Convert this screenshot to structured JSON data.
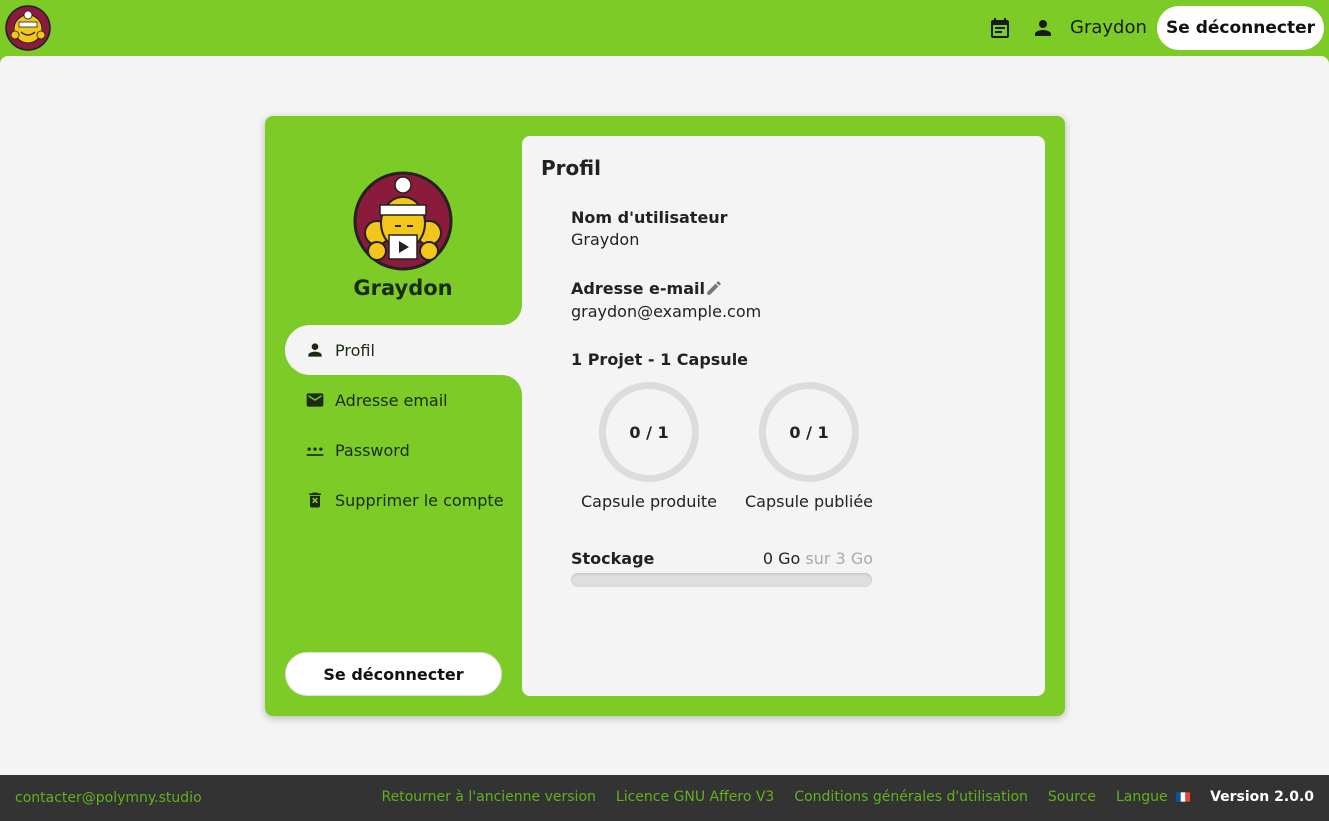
{
  "app": {
    "brand_color": "#7ccb27",
    "logo_icon": "polymny-mascot-logo"
  },
  "topbar": {
    "calendar_icon": "calendar-icon",
    "user_icon": "person-icon",
    "username": "Graydon",
    "logout_label": "Se déconnecter"
  },
  "sidebar": {
    "username": "Graydon",
    "items": [
      {
        "label": "Profil",
        "icon": "person-icon",
        "active": true
      },
      {
        "label": "Adresse email",
        "icon": "mail-icon",
        "active": false
      },
      {
        "label": "Password",
        "icon": "password-icon",
        "active": false
      },
      {
        "label": "Supprimer le compte",
        "icon": "trash-icon",
        "active": false
      }
    ],
    "logout_label": "Se déconnecter"
  },
  "profile": {
    "title": "Profil",
    "username_label": "Nom d'utilisateur",
    "username_value": "Graydon",
    "email_label": "Adresse e-mail",
    "email_value": "graydon@example.com",
    "projects_summary": "1 Projet - 1 Capsule",
    "produced": {
      "value": "0 / 1",
      "label": "Capsule produite",
      "fraction": 0
    },
    "published": {
      "value": "0 / 1",
      "label": "Capsule publiée",
      "fraction": 0
    },
    "storage": {
      "label": "Stockage",
      "used": "0 Go",
      "total": "sur 3 Go",
      "fraction": 0
    }
  },
  "footer": {
    "contact": "contacter@polymny.studio",
    "links": [
      "Retourner à l'ancienne version",
      "Licence GNU Affero V3",
      "Conditions générales d'utilisation",
      "Source"
    ],
    "language_label": "Langue",
    "version": "Version 2.0.0"
  }
}
